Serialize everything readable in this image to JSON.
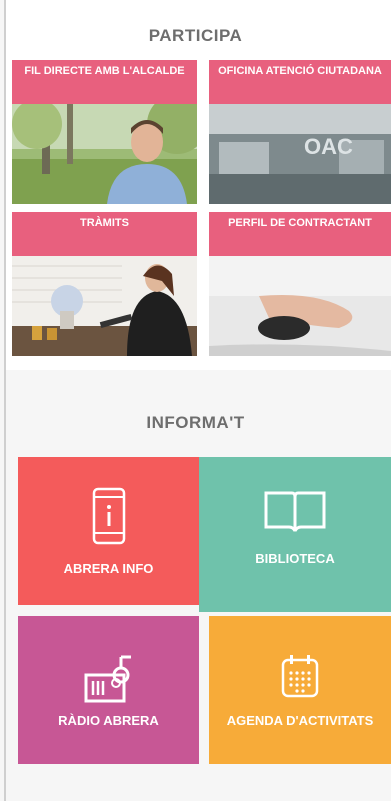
{
  "participa": {
    "title": "PARTICIPA",
    "tiles": [
      {
        "label": "FIL DIRECTE AMB L'ALCALDE"
      },
      {
        "label": "OFICINA ATENCIÓ CIUTADANA",
        "photo_text": "OAC"
      },
      {
        "label": "TRÀMITS"
      },
      {
        "label": "PERFIL DE CONTRACTANT"
      }
    ]
  },
  "informat": {
    "title": "INFORMA'T",
    "tiles": [
      {
        "label": "ABRERA INFO",
        "icon": "smartphone-info-icon",
        "color": "#f45b5b"
      },
      {
        "label": "BIBLIOTECA",
        "icon": "book-icon",
        "color": "#6fc2ab"
      },
      {
        "label": "RÀDIO ABRERA",
        "icon": "radio-icon",
        "color": "#c75795"
      },
      {
        "label": "AGENDA D'ACTIVITATS",
        "icon": "calendar-icon",
        "color": "#f7ab39"
      }
    ]
  },
  "colors": {
    "banner": "#e8607e",
    "background": "#f6f6f6",
    "title": "#6e6e6e"
  }
}
